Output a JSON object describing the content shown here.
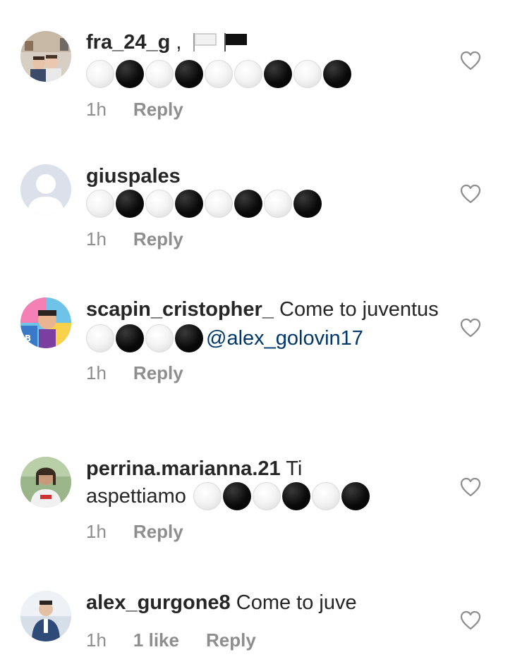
{
  "comments": [
    {
      "username": "fra_24_g",
      "text_after_user": " ,",
      "emoji_pattern": [
        "white",
        "black",
        "white",
        "black",
        "white",
        "white",
        "black",
        "white",
        "black"
      ],
      "emoji_flags": [
        "white-flag",
        "black-flag"
      ],
      "time": "1h",
      "reply_label": "Reply"
    },
    {
      "username": "giuspales",
      "emoji_pattern": [
        "white",
        "black",
        "white",
        "black",
        "white",
        "black",
        "white",
        "black"
      ],
      "time": "1h",
      "reply_label": "Reply"
    },
    {
      "username": "scapin_cristopher_",
      "text": "Come to juventus",
      "emoji_pattern": [
        "white",
        "black",
        "white",
        "black"
      ],
      "mention": "@alex_golovin17",
      "time": "1h",
      "reply_label": "Reply"
    },
    {
      "username": "perrina.marianna.21",
      "text_first": "Ti",
      "text_second": "aspettiamo",
      "emoji_pattern": [
        "white",
        "black",
        "white",
        "black",
        "white",
        "black"
      ],
      "time": "1h",
      "reply_label": "Reply"
    },
    {
      "username": "alex_gurgone8",
      "text": "Come to juve",
      "time": "1h",
      "likes": "1 like",
      "reply_label": "Reply"
    }
  ],
  "icons": {
    "like": "heart-icon",
    "default_avatar": "user-silhouette-icon"
  },
  "colors": {
    "meta_gray": "#8e8e8e",
    "mention_blue": "#00376b",
    "text": "#262626"
  }
}
